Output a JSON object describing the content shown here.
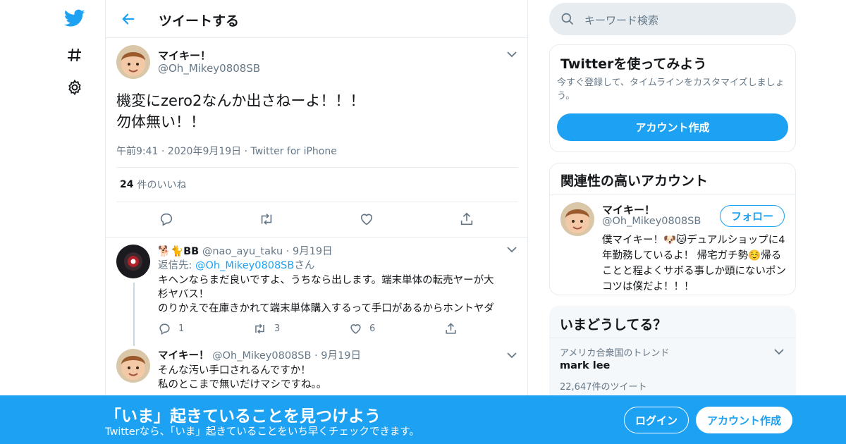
{
  "colors": {
    "brand": "#1da1f2",
    "text": "#14171a",
    "muted": "#657786",
    "border": "#e6ecf0"
  },
  "nav": {
    "icons": [
      "twitter-bird-icon",
      "hashtag-icon",
      "gear-icon"
    ]
  },
  "header": {
    "title": "ツイートする"
  },
  "tweet": {
    "name": "マイキー！",
    "handle": "@Oh_Mikey0808SB",
    "text": "機変にzero2なんか出さねーよ！！！\n勿体無い！！",
    "time": "午前9:41",
    "date": "2020年9月19日",
    "source": "Twitter for iPhone",
    "likes_count": "24",
    "likes_label": "件のいいね"
  },
  "replies": [
    {
      "name": "🐕🐈BB",
      "handle": "@nao_ayu_taku",
      "date": "9月19日",
      "reply_to_prefix": "返信先: ",
      "reply_to_handle": "@Oh_Mikey0808SB",
      "reply_to_suffix": "さん",
      "text1": "キヘンならまだ良いですよ、うちなら出します。端末単体の転売ヤーが大",
      "text2": "杉ヤバス！",
      "text3": "のりかえで在庫きかれて端末単体購入するって手口があるからホントヤダ",
      "reply_count": "1",
      "retweet_count": "3",
      "like_count": "6"
    },
    {
      "name": "マイキー！",
      "handle": "@Oh_Mikey0808SB",
      "date": "9月19日",
      "text1": "そんな汚い手口されるんですか！",
      "text2": "私のとこまで無いだけマシですね。。"
    }
  ],
  "search": {
    "placeholder": "キーワード検索"
  },
  "signup_card": {
    "title": "Twitterを使ってみよう",
    "description": "今すぐ登録して、タイムラインをカスタマイズしましょう。",
    "button": "アカウント作成"
  },
  "related": {
    "title": "関連性の高いアカウント",
    "name": "マイキー！",
    "handle": "@Oh_Mikey0808SB",
    "follow": "フォロー",
    "bio": "僕マイキー！🐶🐱デュアルショップに4年勤務しているよ！ 帰宅ガチ勢☺️帰ることと程よくサボる事しか頭にないポンコツは僕だよ！！！"
  },
  "trends": {
    "title": "いまどうしてる？",
    "context": "アメリカ合衆国のトレンド",
    "topic": "mark lee",
    "count": "22,647件のツイート"
  },
  "banner": {
    "title": "「いま」起きていることを見つけよう",
    "subtitle": "Twitterなら、「いま」起きていることをいち早くチェックできます。",
    "login": "ログイン",
    "signup": "アカウント作成"
  }
}
